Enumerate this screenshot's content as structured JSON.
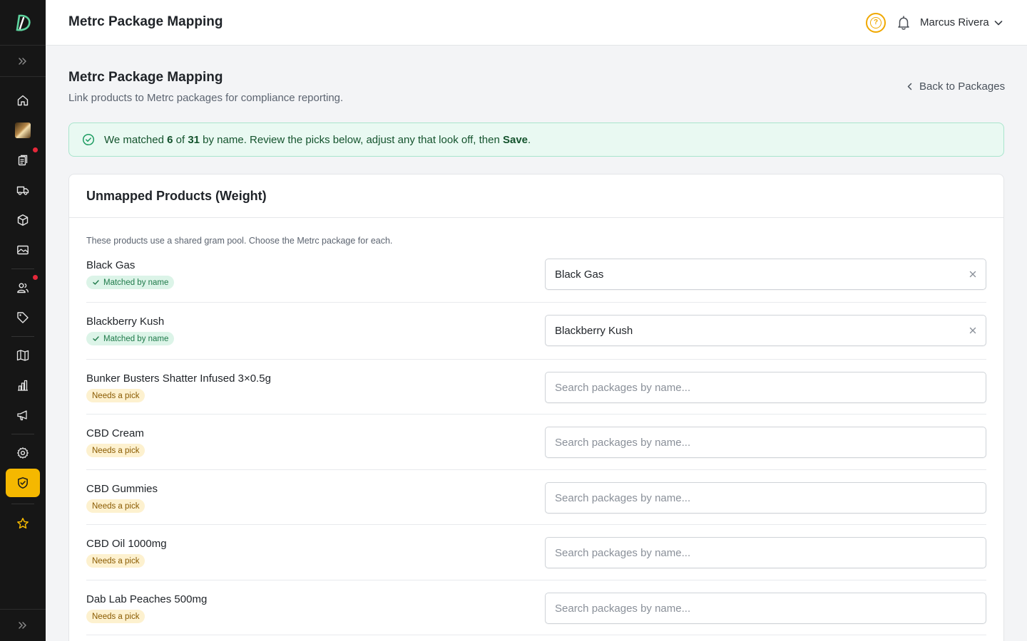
{
  "header": {
    "title": "Metrc Package Mapping",
    "user_name": "Marcus Rivera",
    "help_glyph": "?"
  },
  "page": {
    "title": "Metrc Package Mapping",
    "subtitle": "Link products to Metrc packages for compliance reporting.",
    "back_label": "Back to Packages"
  },
  "banner": {
    "prefix": "We matched ",
    "matched": "6",
    "of_word": " of ",
    "total": "31",
    "middle": " by name. Review the picks below, adjust any that look off, then ",
    "action": "Save",
    "suffix": "."
  },
  "card": {
    "title": "Unmapped Products (Weight)",
    "note": "These products use a shared gram pool. Choose the Metrc package for each.",
    "search_placeholder": "Search packages by name...",
    "rows": [
      {
        "name": "Black Gas",
        "status": "Matched by name",
        "value": "Black Gas"
      },
      {
        "name": "Blackberry Kush",
        "status": "Matched by name",
        "value": "Blackberry Kush"
      },
      {
        "name": "Bunker Busters Shatter Infused 3×0.5g",
        "status": "Needs a pick",
        "value": ""
      },
      {
        "name": "CBD Cream",
        "status": "Needs a pick",
        "value": ""
      },
      {
        "name": "CBD Gummies",
        "status": "Needs a pick",
        "value": ""
      },
      {
        "name": "CBD Oil 1000mg",
        "status": "Needs a pick",
        "value": ""
      },
      {
        "name": "Dab Lab Peaches 500mg",
        "status": "Needs a pick",
        "value": ""
      }
    ]
  },
  "sidebar": {
    "items": [
      {
        "icon": "home-icon"
      },
      {
        "icon": "product-thumbnail"
      },
      {
        "icon": "clipboard-icon",
        "alert": true
      },
      {
        "icon": "truck-icon"
      },
      {
        "icon": "box-icon"
      },
      {
        "icon": "image-icon"
      },
      {
        "icon": "users-icon",
        "alert": true
      },
      {
        "icon": "tag-icon"
      },
      {
        "icon": "map-icon"
      },
      {
        "icon": "bar-chart-icon"
      },
      {
        "icon": "megaphone-icon"
      },
      {
        "icon": "settings-icon"
      },
      {
        "icon": "shield-check-icon",
        "active": true
      },
      {
        "icon": "star-icon"
      }
    ]
  },
  "colors": {
    "sidebar_bg": "#161616",
    "accent": "#f5b800",
    "alert_dot": "#e5283a",
    "banner_bg": "#e9f9f2",
    "matched_badge_bg": "#dcf4e8",
    "needs_badge_bg": "#fdf1cf"
  }
}
